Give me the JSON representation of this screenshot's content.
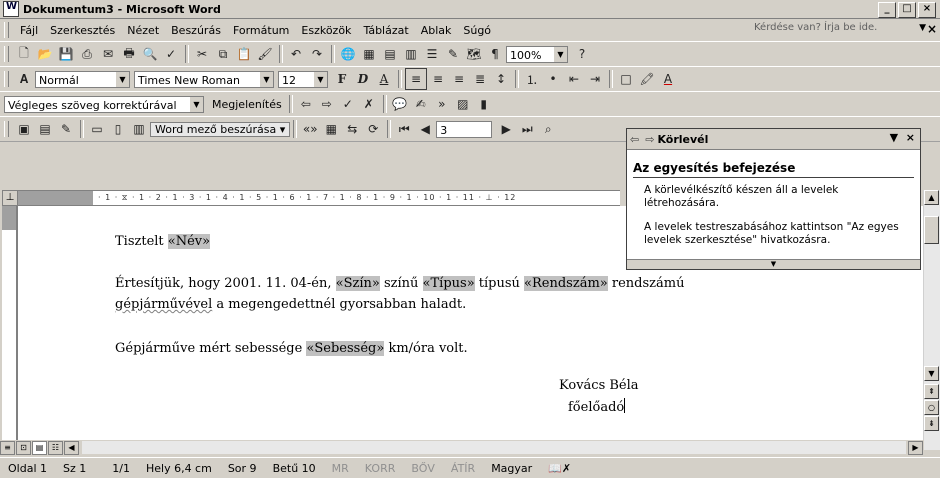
{
  "window": {
    "title": "Dokumentum3 - Microsoft Word",
    "min": "_",
    "max": "□",
    "close": "×"
  },
  "menu": {
    "items": [
      "Fájl",
      "Szerkesztés",
      "Nézet",
      "Beszúrás",
      "Formátum",
      "Eszközök",
      "Táblázat",
      "Ablak",
      "Súgó"
    ],
    "help_placeholder": "Kérdése van? Írja be ide.",
    "doc_close": "×"
  },
  "toolbar_standard": {
    "zoom": "100%"
  },
  "toolbar_format": {
    "style": "Normál",
    "font": "Times New Roman",
    "size": "12"
  },
  "toolbar_review": {
    "display_mode": "Végleges szöveg korrektúrával",
    "show_label": "Megjelenítés"
  },
  "toolbar_mailmerge": {
    "insert_word_field": "Word mező beszúrása",
    "record": "3"
  },
  "ruler": {
    "numbers": "· 1 · ⧖ · 1 · 2 · 1 · 3 · 1 · 4 · 1 · 5 · 1 · 6 · 1 · 7 · 1 · 8 · 1 · 9 · 1 · 10 · 1 · 11 · ⊥ · 12"
  },
  "document": {
    "greeting_text": "Tisztelt ",
    "field_nev": "«Név»",
    "line2_a": "Értesítjük, hogy 2001. 11. 04-én, ",
    "field_szin": "«Szín»",
    "line2_b": " színű ",
    "field_tipus": "«Típus»",
    "line2_c": " típusú ",
    "field_rendszam": "«Rendszám»",
    "line2_d": " rendszámú",
    "line3_squig": "gépjárművével",
    "line3_rest": " a megengedettnél gyorsabban haladt.",
    "line4_a": "Gépjárműve mért sebessége ",
    "field_sebesseg": "«Sebesség»",
    "line4_b": " km/óra volt.",
    "signature_name": "Kovács Béla",
    "signature_title": "főelőadó"
  },
  "taskpane": {
    "title": "Körlevél",
    "section": "Az egyesítés befejezése",
    "text1": "A körlevélkészítő készen áll a levelek létrehozására.",
    "text2": "A levelek testreszabásához kattintson \"Az egyes levelek szerkesztése\" hivatkozásra."
  },
  "status": {
    "page": "Oldal 1",
    "section": "Sz 1",
    "pages": "1/1",
    "position": "Hely 6,4 cm",
    "line": "Sor 9",
    "column": "Betű 10",
    "mr": "MR",
    "korr": "KORR",
    "bov": "BŐV",
    "atir": "ÁTÍR",
    "language": "Magyar"
  }
}
